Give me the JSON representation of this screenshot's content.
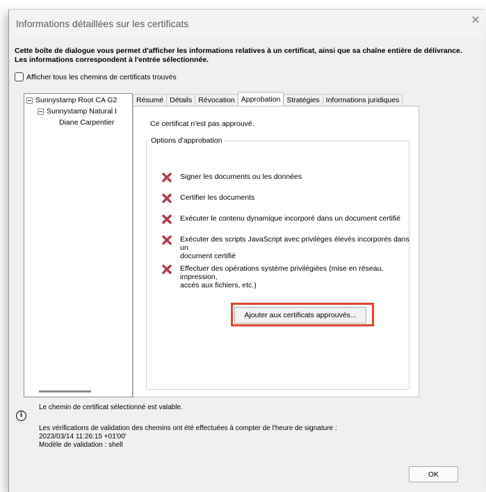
{
  "window": {
    "title": "Informations détaillées sur les certificats",
    "close_icon": "close-icon"
  },
  "intro": {
    "line1": "Cette boîte de dialogue vous permet d'afficher les informations relatives à un certificat, ainsi que sa chaîne entière de délivrance.",
    "line2": "Les informations correspondent à l'entrée sélectionnée."
  },
  "show_all_paths": {
    "label": "Afficher tous les chemins de certificats trouvés",
    "checked": false
  },
  "tree": {
    "items": [
      {
        "label": "Sunnystamp Root CA G2"
      },
      {
        "label": "Sunnystamp Natural I"
      },
      {
        "label": "Diane Carpentier"
      }
    ]
  },
  "tabs": [
    {
      "label": "Résumé"
    },
    {
      "label": "Détails"
    },
    {
      "label": "Révocation"
    },
    {
      "label": "Approbation",
      "active": true
    },
    {
      "label": "Stratégies"
    },
    {
      "label": "Informations juridiques"
    }
  ],
  "approval": {
    "status": "Ce certificat n'est pas approuvé.",
    "group_label": "Options d'approbation",
    "permissions": [
      {
        "line1": "Signer les documents ou les données",
        "line2": ""
      },
      {
        "line1": "Certifier les documents",
        "line2": ""
      },
      {
        "line1": "Exécuter le contenu dynamique incorporé dans un document certifié",
        "line2": ""
      },
      {
        "line1": "Exécuter des scripts JavaScript avec privilèges élevés incorporés dans un",
        "line2": "document certifié"
      },
      {
        "line1": "Effectuer des opérations système privilégiées (mise en réseau, impression,",
        "line2": "accès aux fichiers, etc.)"
      }
    ],
    "permission_icon": "red-x-icon",
    "add_button": "Ajouter aux certificats approuvés...",
    "highlight_color": "#e0462f"
  },
  "footer": {
    "valid_text": "Le chemin de certificat sélectionné est valable.",
    "validation_line1": "Les vérifications de validation des chemins ont été effectuées à compter de l'heure de signature :",
    "validation_line2": "2023/03/14 11:26:15 +01'00'",
    "validation_line3": "Modèle de validation : shell",
    "ok_button": "OK"
  }
}
